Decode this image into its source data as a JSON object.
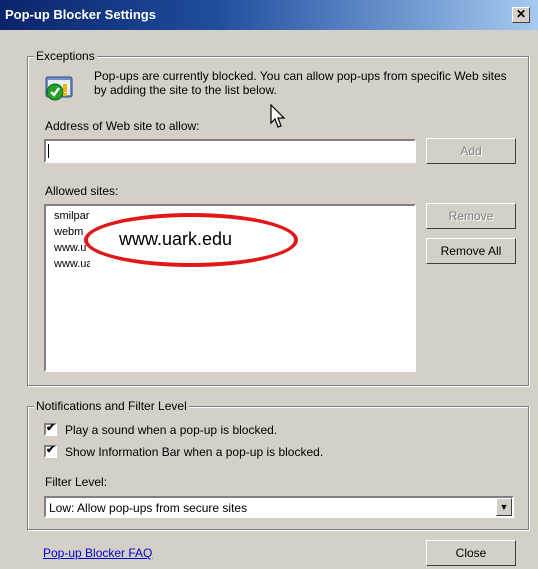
{
  "dialog": {
    "title": "Pop-up Blocker Settings",
    "close_glyph": "✕"
  },
  "exceptions": {
    "group_label": "Exceptions",
    "info_text": "Pop-ups are currently blocked.  You can allow pop-ups from specific Web sites by adding the site to the list below.",
    "address_label": "Address of Web site to allow:",
    "address_value": "",
    "add_button": "Add",
    "allowed_label": "Allowed sites:",
    "allowed_sites": [
      "smilpars",
      "webm",
      "www.u",
      "www.ua"
    ],
    "remove_button": "Remove",
    "remove_all_button": "Remove All",
    "annotation_text": "www.uark.edu",
    "annotation_color": "#e21818"
  },
  "notifications": {
    "group_label": "Notifications and Filter Level",
    "play_sound_label": "Play a sound when a pop-up is blocked.",
    "play_sound_checked": true,
    "info_bar_label": "Show Information Bar when a pop-up is blocked.",
    "info_bar_checked": true,
    "filter_label": "Filter Level:",
    "filter_value": "Low: Allow pop-ups from secure sites"
  },
  "footer": {
    "faq_link": "Pop-up Blocker FAQ",
    "close_button": "Close"
  },
  "icons": {
    "shield": "shield-check-icon",
    "dropdown": "chevron-down-icon",
    "cursor": "mouse-pointer-icon"
  },
  "colors": {
    "titlebar_start": "#0a246a",
    "titlebar_end": "#a6caf0",
    "dialog_bg": "#d4d0c8",
    "link": "#0000cc"
  }
}
